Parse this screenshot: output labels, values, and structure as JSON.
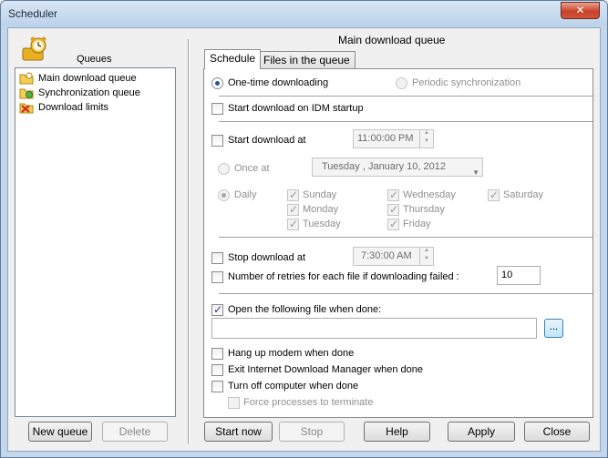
{
  "window": {
    "title": "Scheduler",
    "close_glyph": "✕"
  },
  "left": {
    "queues_label": "Queues",
    "items": [
      {
        "label": "Main download queue",
        "icon": "folder-clock-icon",
        "color": "#e8b020"
      },
      {
        "label": "Synchronization queue",
        "icon": "folder-sync-icon",
        "color": "#5db049"
      },
      {
        "label": "Download limits",
        "icon": "limit-x-icon",
        "color": "#d62b1f"
      }
    ],
    "new_queue": "New queue",
    "delete": "Delete"
  },
  "right": {
    "queue_title": "Main download queue",
    "tabs": [
      "Schedule",
      "Files in the queue"
    ],
    "one_time": "One-time downloading",
    "periodic": "Periodic synchronization",
    "start_on_startup": "Start download on IDM startup",
    "start_at": "Start download at",
    "start_time": "11:00:00 PM",
    "once_at": "Once at",
    "date": "Tuesday  ,  January  10, 2012",
    "daily": "Daily",
    "days": {
      "sunday": "Sunday",
      "monday": "Monday",
      "tuesday": "Tuesday",
      "wednesday": "Wednesday",
      "thursday": "Thursday",
      "friday": "Friday",
      "saturday": "Saturday"
    },
    "stop_at": "Stop download at",
    "stop_time": "7:30:00 AM",
    "retries": "Number of retries for each file if downloading failed :",
    "retries_value": "10",
    "open_file": "Open the following file when done:",
    "open_file_path": "",
    "browse": "...",
    "hang_up": "Hang up modem when done",
    "exit_idm": "Exit Internet Download Manager when done",
    "turn_off": "Turn off computer when done",
    "force": "Force processes to terminate"
  },
  "buttons": {
    "start_now": "Start now",
    "stop": "Stop",
    "help": "Help",
    "apply": "Apply",
    "close": "Close"
  }
}
